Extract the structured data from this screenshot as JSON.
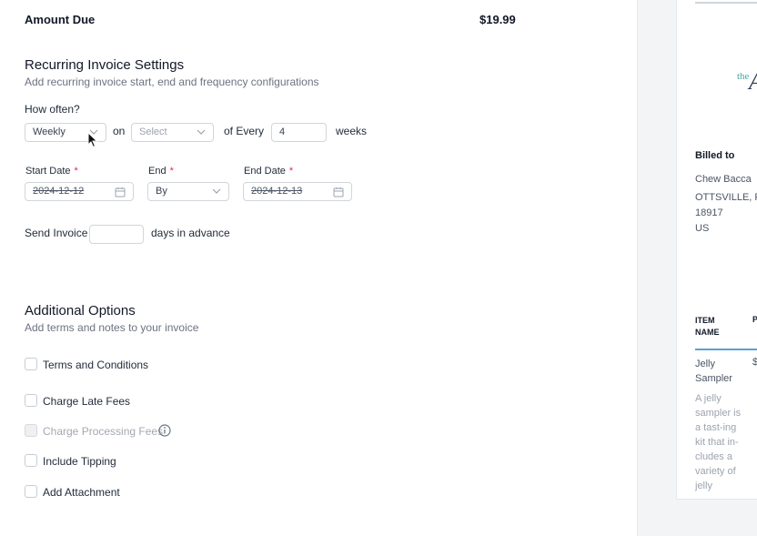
{
  "amount": {
    "label": "Amount Due",
    "value": "$19.99"
  },
  "recurring": {
    "title": "Recurring Invoice Settings",
    "subtitle": "Add recurring invoice start, end and frequency configurations",
    "how_often_label": "How often?",
    "frequency_value": "Weekly",
    "on_label": "on",
    "day_select_placeholder": "Select",
    "of_every_label": "of Every",
    "interval_value": "4",
    "interval_unit": "weeks",
    "start_date_label": "Start Date",
    "start_date_value": "2024-12-12",
    "end_label": "End",
    "end_value": "By",
    "end_date_label": "End Date",
    "end_date_value": "2024-12-13",
    "required_mark": "*",
    "send_invoice_label": "Send Invoice",
    "send_invoice_value": "",
    "days_advance_label": "days in advance"
  },
  "additional": {
    "title": "Additional Options",
    "subtitle": "Add terms and notes to your invoice",
    "options": [
      {
        "label": "Terms and Conditions",
        "checked": false,
        "disabled": false
      },
      {
        "label": "Charge Late Fees",
        "checked": false,
        "disabled": false
      },
      {
        "label": "Charge Processing Fees",
        "checked": false,
        "disabled": true
      },
      {
        "label": "Include Tipping",
        "checked": false,
        "disabled": false
      },
      {
        "label": "Add Attachment",
        "checked": false,
        "disabled": false
      }
    ]
  },
  "preview": {
    "logo_small": "the",
    "logo_large": "A",
    "billed_to_label": "Billed to",
    "customer_name": "Chew Bacca",
    "address_line1": "OTTSVILLE, PA",
    "address_line2": "18917",
    "address_line3": "US",
    "col_item": "ITEM NAME",
    "col_price": "P",
    "item_name": "Jelly Sampler",
    "item_price": "$",
    "item_description": "A jelly sampler is a tast-ing kit that in-cludes a variety of jelly"
  },
  "colors": {
    "required": "#e0245e",
    "accent": "#5aa0d8",
    "logo_teal": "#4aa6a0"
  }
}
